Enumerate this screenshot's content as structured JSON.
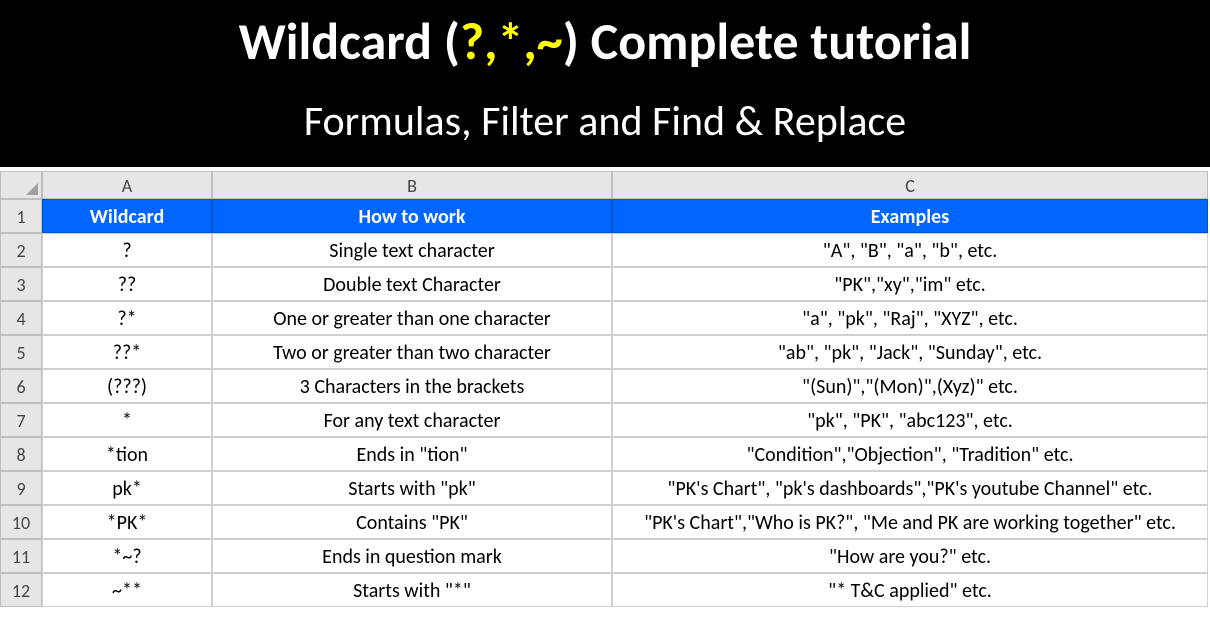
{
  "banner": {
    "title_prefix": "Wildcard (",
    "title_highlight": "?,*,~",
    "title_suffix": ") Complete tutorial",
    "subtitle": "Formulas, Filter and Find & Replace"
  },
  "columns": [
    "A",
    "B",
    "C"
  ],
  "headers": {
    "a": "Wildcard",
    "b": "How to work",
    "c": "Examples"
  },
  "rows": [
    {
      "n": "2",
      "a": "?",
      "b": "Single text character",
      "c": "\"A\", \"B\", \"a\", \"b\", etc."
    },
    {
      "n": "3",
      "a": "??",
      "b": "Double text Character",
      "c": "\"PK\",\"xy\",\"im\" etc."
    },
    {
      "n": "4",
      "a": "?*",
      "b": "One or greater than one character",
      "c": "\"a\", \"pk\", \"Raj\", \"XYZ\", etc."
    },
    {
      "n": "5",
      "a": "??*",
      "b": "Two or greater than two character",
      "c": "\"ab\", \"pk\", \"Jack\", \"Sunday\", etc."
    },
    {
      "n": "6",
      "a": "(???)",
      "b": "3 Characters in the brackets",
      "c": "\"(Sun)\",\"(Mon)\",(Xyz)\" etc."
    },
    {
      "n": "7",
      "a": "*",
      "b": "For any text character",
      "c": "\"pk\", \"PK\", \"abc123\", etc."
    },
    {
      "n": "8",
      "a": "*tion",
      "b": "Ends in \"tion\"",
      "c": "\"Condition\",\"Objection\", \"Tradition\" etc."
    },
    {
      "n": "9",
      "a": "pk*",
      "b": "Starts with \"pk\"",
      "c": "\"PK's Chart\", \"pk's dashboards\",\"PK's youtube Channel\" etc."
    },
    {
      "n": "10",
      "a": "*PK*",
      "b": "Contains \"PK\"",
      "c": "\"PK's Chart\",\"Who is PK?\", \"Me and PK are working together\" etc."
    },
    {
      "n": "11",
      "a": "*~?",
      "b": "Ends in question mark",
      "c": "\"How are you?\" etc."
    },
    {
      "n": "12",
      "a": "~**",
      "b": "Starts with \"*\"",
      "c": "\"* T&C applied\" etc."
    }
  ]
}
